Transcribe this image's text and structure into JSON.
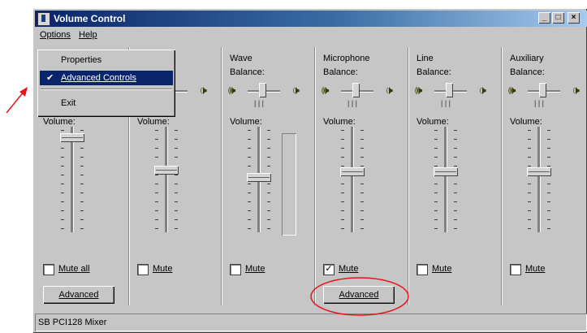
{
  "window": {
    "title": "Volume Control"
  },
  "menubar": {
    "items": [
      "Options",
      "Help"
    ]
  },
  "options_menu": {
    "items": [
      {
        "label": "Properties",
        "checked": false,
        "highlighted": false
      },
      {
        "label": "Advanced Controls",
        "checked": true,
        "highlighted": true
      },
      {
        "label": "Exit",
        "checked": false,
        "highlighted": false
      }
    ]
  },
  "columns": [
    {
      "title": "",
      "balance_label": "",
      "volume_label": "Volume:",
      "volume_level": 0.93,
      "mute_label": "Mute all",
      "muted": false,
      "advanced_label": "Advanced",
      "show_meter": false
    },
    {
      "title": "",
      "balance_label": "",
      "volume_label": "Volume:",
      "volume_level": 0.6,
      "mute_label": "Mute",
      "muted": false,
      "advanced_label": "",
      "show_meter": false
    },
    {
      "title": "Wave",
      "balance_label": "Balance:",
      "volume_label": "Volume:",
      "volume_level": 0.52,
      "mute_label": "Mute",
      "muted": false,
      "advanced_label": "",
      "show_meter": true
    },
    {
      "title": "Microphone",
      "balance_label": "Balance:",
      "volume_label": "Volume:",
      "volume_level": 0.58,
      "mute_label": "Mute",
      "muted": true,
      "advanced_label": "Advanced",
      "show_meter": false
    },
    {
      "title": "Line",
      "balance_label": "Balance:",
      "volume_label": "Volume:",
      "volume_level": 0.58,
      "mute_label": "Mute",
      "muted": false,
      "advanced_label": "",
      "show_meter": false
    },
    {
      "title": "Auxiliary",
      "balance_label": "Balance:",
      "volume_label": "Volume:",
      "volume_level": 0.58,
      "mute_label": "Mute",
      "muted": false,
      "advanced_label": "",
      "show_meter": false
    }
  ],
  "statusbar": {
    "text": "SB PCI128 Mixer"
  },
  "colors": {
    "annotation": "#e8141c",
    "title_active": "#0a246a",
    "face": "#c6c6c6"
  }
}
